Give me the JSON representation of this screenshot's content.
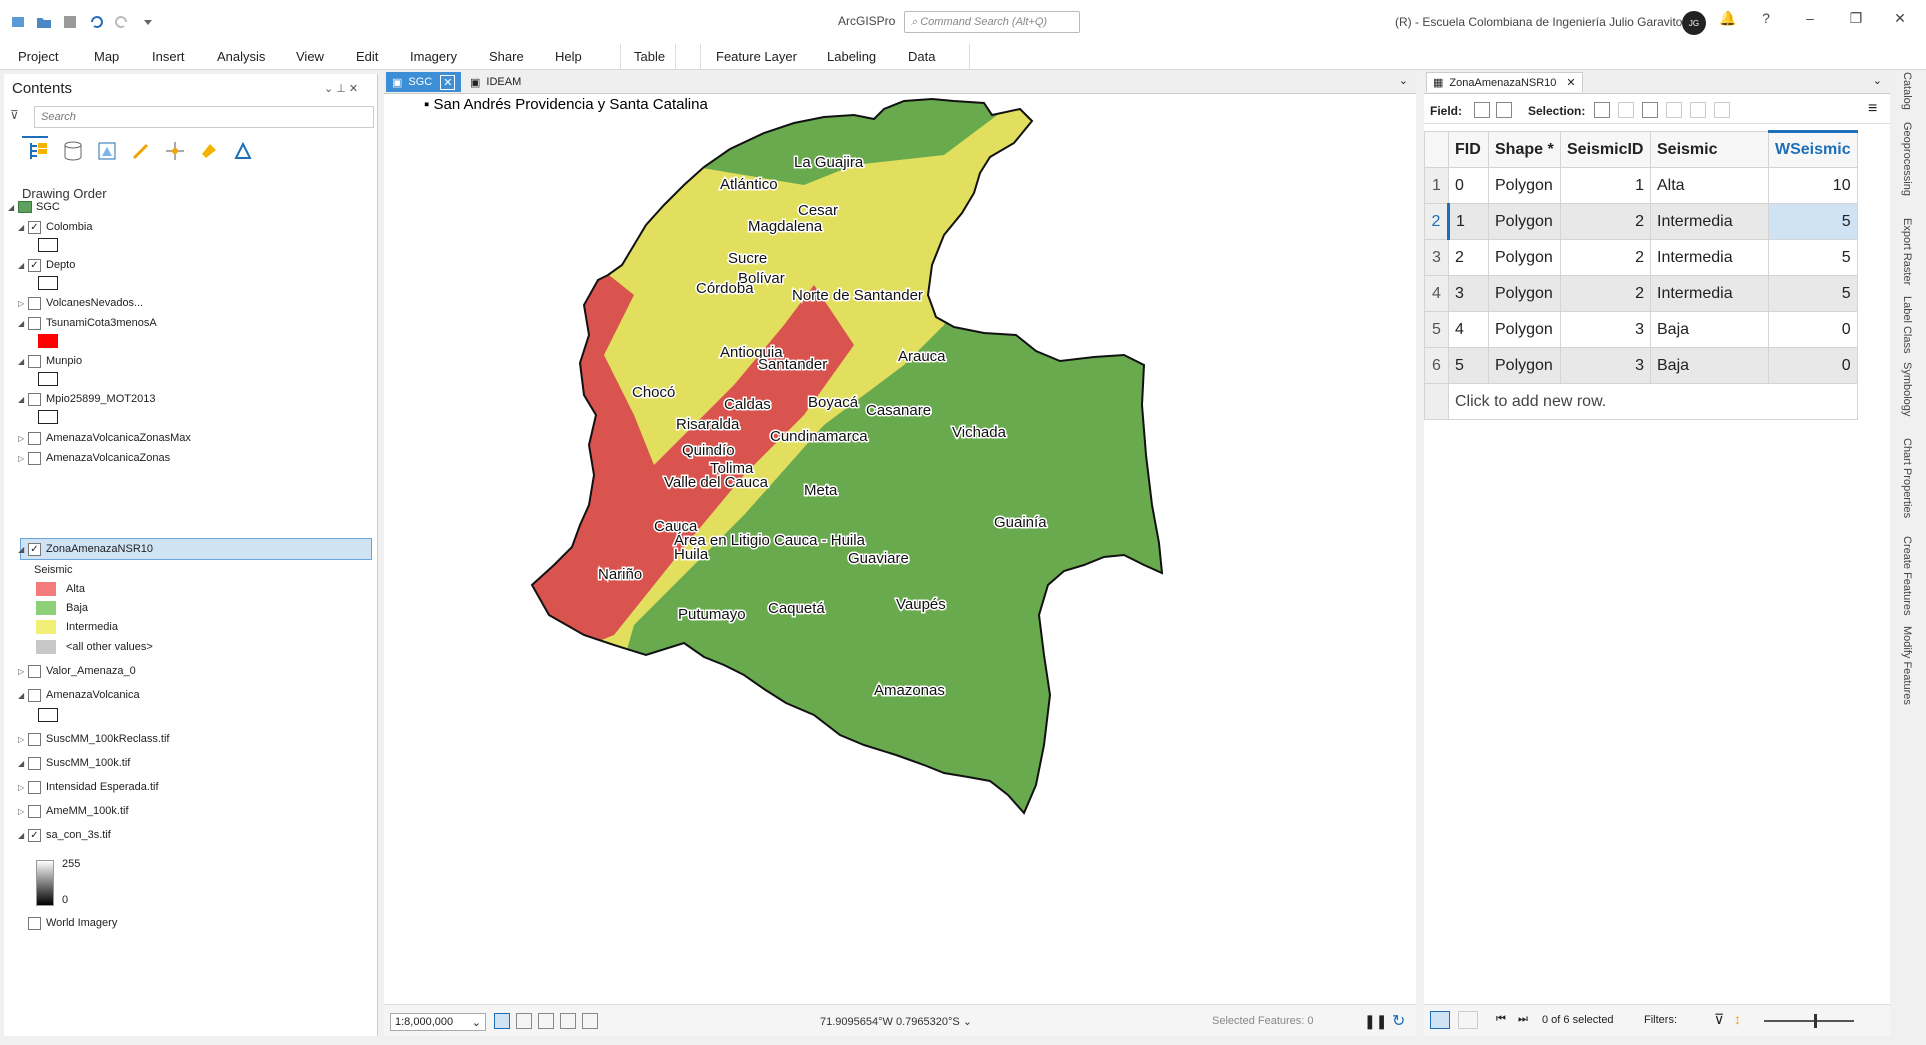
{
  "app": {
    "title": "ArcGISPro",
    "command_search": "Command Search (Alt+Q)",
    "org": "(R) - Escuela Colombiana de Ingeniería Julio Garavito",
    "avatar_initials": "JG"
  },
  "menu": {
    "items": [
      "Project",
      "Map",
      "Insert",
      "Analysis",
      "View",
      "Edit",
      "Imagery",
      "Share",
      "Help"
    ],
    "table_tab": "Table",
    "feature_layer": "Feature Layer",
    "labeling": "Labeling",
    "data": "Data"
  },
  "contents": {
    "title": "Contents",
    "search_placeholder": "Search",
    "drawing_order": "Drawing Order",
    "map_name": "SGC",
    "layers": [
      {
        "name": "Colombia",
        "checked": true
      },
      {
        "name": "Depto",
        "checked": true
      },
      {
        "name": "VolcanesNevados...",
        "checked": false
      },
      {
        "name": "TsunamiCota3menosA",
        "checked": false
      },
      {
        "name": "Munpio",
        "checked": false
      },
      {
        "name": "Mpio25899_MOT2013",
        "checked": false
      },
      {
        "name": "AmenazaVolcanicaZonasMax",
        "checked": false
      },
      {
        "name": "AmenazaVolcanicaZonas",
        "checked": false
      },
      {
        "name": "ZonaAmenazaNSR10",
        "checked": true
      },
      {
        "name": "Valor_Amenaza_0",
        "checked": false
      },
      {
        "name": "AmenazaVolcanica",
        "checked": false
      },
      {
        "name": "SuscMM_100kReclass.tif",
        "checked": false
      },
      {
        "name": "SuscMM_100k.tif",
        "checked": false
      },
      {
        "name": "Intensidad Esperada.tif",
        "checked": false
      },
      {
        "name": "AmeMM_100k.tif",
        "checked": false
      },
      {
        "name": "sa_con_3s.tif",
        "checked": true
      },
      {
        "name": "World Imagery",
        "checked": false
      }
    ],
    "legend_field": "Seismic",
    "legend": [
      {
        "label": "Alta",
        "color": "#f47b7b"
      },
      {
        "label": "Baja",
        "color": "#8ed07a"
      },
      {
        "label": "Intermedia",
        "color": "#f2ef77"
      },
      {
        "label": "<all other values>",
        "color": "#c8c8c8"
      }
    ],
    "raster_high": "255",
    "raster_low": "0"
  },
  "mapview": {
    "tabs": [
      "SGC",
      "IDEAM"
    ],
    "inset_label": "San Andrés Providencia y Santa Catalina",
    "scale": "1:8,000,000",
    "coords": "71.9095654°W 0.7965320°S",
    "selected_features": "Selected Features: 0",
    "colors": {
      "alta": "#d9534f",
      "intermedia": "#e3df5e",
      "baja": "#6aaa4f"
    },
    "labels": [
      "La Guajira",
      "Atlántico",
      "Cesar",
      "Magdalena",
      "Sucre",
      "Bolívar",
      "Córdoba",
      "Norte de Santander",
      "Antioquia",
      "Santander",
      "Arauca",
      "Chocó",
      "Caldas",
      "Boyacá",
      "Casanare",
      "Risaralda",
      "Cundinamarca",
      "Vichada",
      "Quindío",
      "Tolima",
      "Valle del Cauca",
      "Meta",
      "Guainía",
      "Cauca",
      "Área en Litigio Cauca - Huila",
      "Huila",
      "Guaviare",
      "Nariño",
      "Putumayo",
      "Caquetá",
      "Vaupés",
      "Amazonas"
    ]
  },
  "table": {
    "tab": "ZonaAmenazaNSR10",
    "field_label": "Field:",
    "selection_label": "Selection:",
    "columns": [
      "FID",
      "Shape *",
      "SeismicID",
      "Seismic",
      "WSeismic"
    ],
    "rows": [
      [
        "1",
        "0",
        "Polygon",
        "1",
        "Alta",
        "10"
      ],
      [
        "2",
        "1",
        "Polygon",
        "2",
        "Intermedia",
        "5"
      ],
      [
        "3",
        "2",
        "Polygon",
        "2",
        "Intermedia",
        "5"
      ],
      [
        "4",
        "3",
        "Polygon",
        "2",
        "Intermedia",
        "5"
      ],
      [
        "5",
        "4",
        "Polygon",
        "3",
        "Baja",
        "0"
      ],
      [
        "6",
        "5",
        "Polygon",
        "3",
        "Baja",
        "0"
      ]
    ],
    "add_row": "Click to add new row.",
    "selected_status": "0 of 6 selected",
    "filters": "Filters:"
  },
  "dock": [
    "Catalog",
    "Geoprocessing",
    "Export Raster",
    "Label Class",
    "Symbology",
    "Chart Properties",
    "Create Features",
    "Modify Features"
  ]
}
